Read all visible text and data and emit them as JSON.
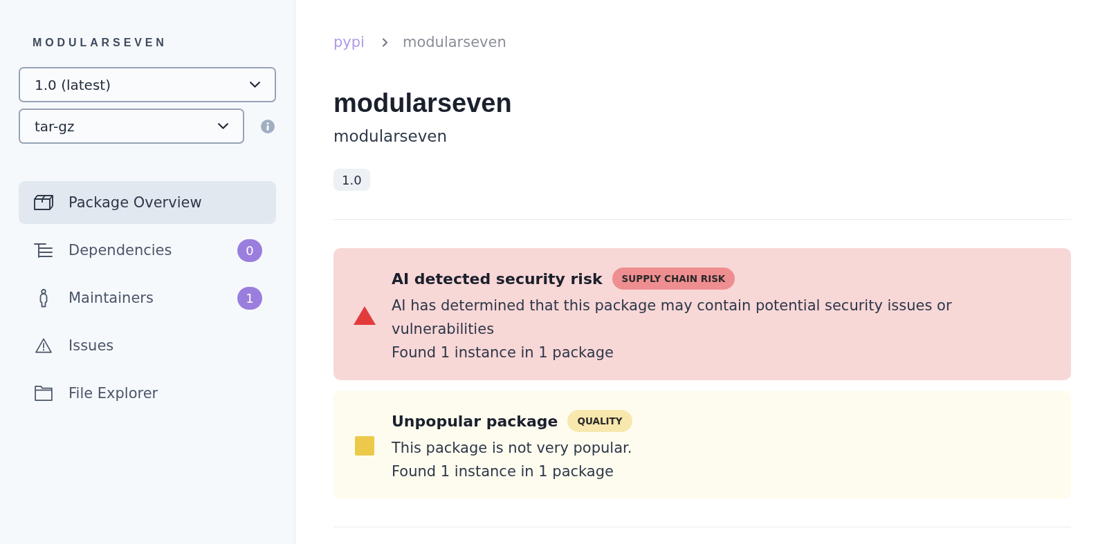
{
  "sidebar": {
    "package_name": "MODULARSEVEN",
    "version_select": {
      "value": "1.0 (latest)"
    },
    "format_select": {
      "value": "tar-gz"
    },
    "nav_items": [
      {
        "kind": "overview",
        "label": "Package Overview",
        "selected": true
      },
      {
        "kind": "dependencies",
        "label": "Dependencies",
        "count": "0",
        "selected": false
      },
      {
        "kind": "maintainers",
        "label": "Maintainers",
        "count": "1",
        "selected": false
      },
      {
        "kind": "issues",
        "label": "Issues",
        "selected": false
      },
      {
        "kind": "files",
        "label": "File Explorer",
        "selected": false
      }
    ]
  },
  "breadcrumb": [
    {
      "kind": "link",
      "label": "pypi"
    },
    {
      "kind": "current",
      "label": "modularseven"
    }
  ],
  "header": {
    "title": "modularseven",
    "subtitle": "modularseven",
    "version_tag": "1.0"
  },
  "alerts": [
    {
      "kind": "critical",
      "title": "AI detected security risk",
      "tag": "SUPPLY CHAIN RISK",
      "description": "AI has determined that this package may contain potential security issues or vulnerabilities",
      "found": "Found 1 instance in 1 package"
    },
    {
      "kind": "warning",
      "title": "Unpopular package",
      "tag": "QUALITY",
      "description": "This package is not very popular.",
      "found": "Found 1 instance in 1 package"
    }
  ]
}
